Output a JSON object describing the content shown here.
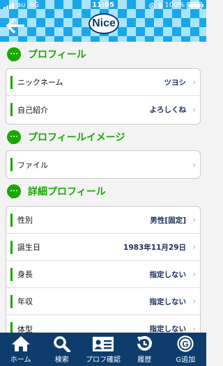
{
  "status": {
    "carrier": "au",
    "network": "4G",
    "time": "11:05",
    "battery": "100%",
    "battery_level": 1.0
  },
  "header": {
    "logo_text": "Nice"
  },
  "sections": {
    "profile": {
      "title": "プロフィール",
      "rows": [
        {
          "label": "ニックネーム",
          "value": "ツヨシ"
        },
        {
          "label": "自己紹介",
          "value": "よろしくね"
        }
      ]
    },
    "profile_image": {
      "title": "プロフィールイメージ",
      "rows": [
        {
          "label": "ファイル",
          "value": ""
        }
      ]
    },
    "details": {
      "title": "詳細プロフィール",
      "rows": [
        {
          "label": "性別",
          "value": "男性[固定]"
        },
        {
          "label": "誕生日",
          "value": "1983年11月29日"
        },
        {
          "label": "身長",
          "value": "指定しない"
        },
        {
          "label": "年収",
          "value": "指定しない"
        },
        {
          "label": "体型",
          "value": "指定しない"
        }
      ]
    }
  },
  "tabbar": [
    {
      "label": "ホーム",
      "icon": "home-icon"
    },
    {
      "label": "検索",
      "icon": "search-icon"
    },
    {
      "label": "プロフ確認",
      "icon": "profile-card-icon"
    },
    {
      "label": "履歴",
      "icon": "history-icon"
    },
    {
      "label": "G追加",
      "icon": "g-add-icon"
    }
  ]
}
